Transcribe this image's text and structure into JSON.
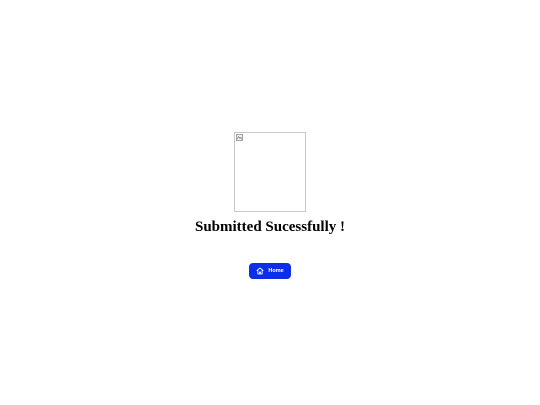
{
  "success": {
    "image_alt": "",
    "title": "Submitted Sucessfully !"
  },
  "actions": {
    "home_label": "Home"
  },
  "colors": {
    "button_background": "#0b2fe6",
    "button_text": "#ffffff",
    "title_text": "#000000"
  },
  "icons": {
    "placeholder": "broken-image-icon",
    "button": "home-icon"
  }
}
